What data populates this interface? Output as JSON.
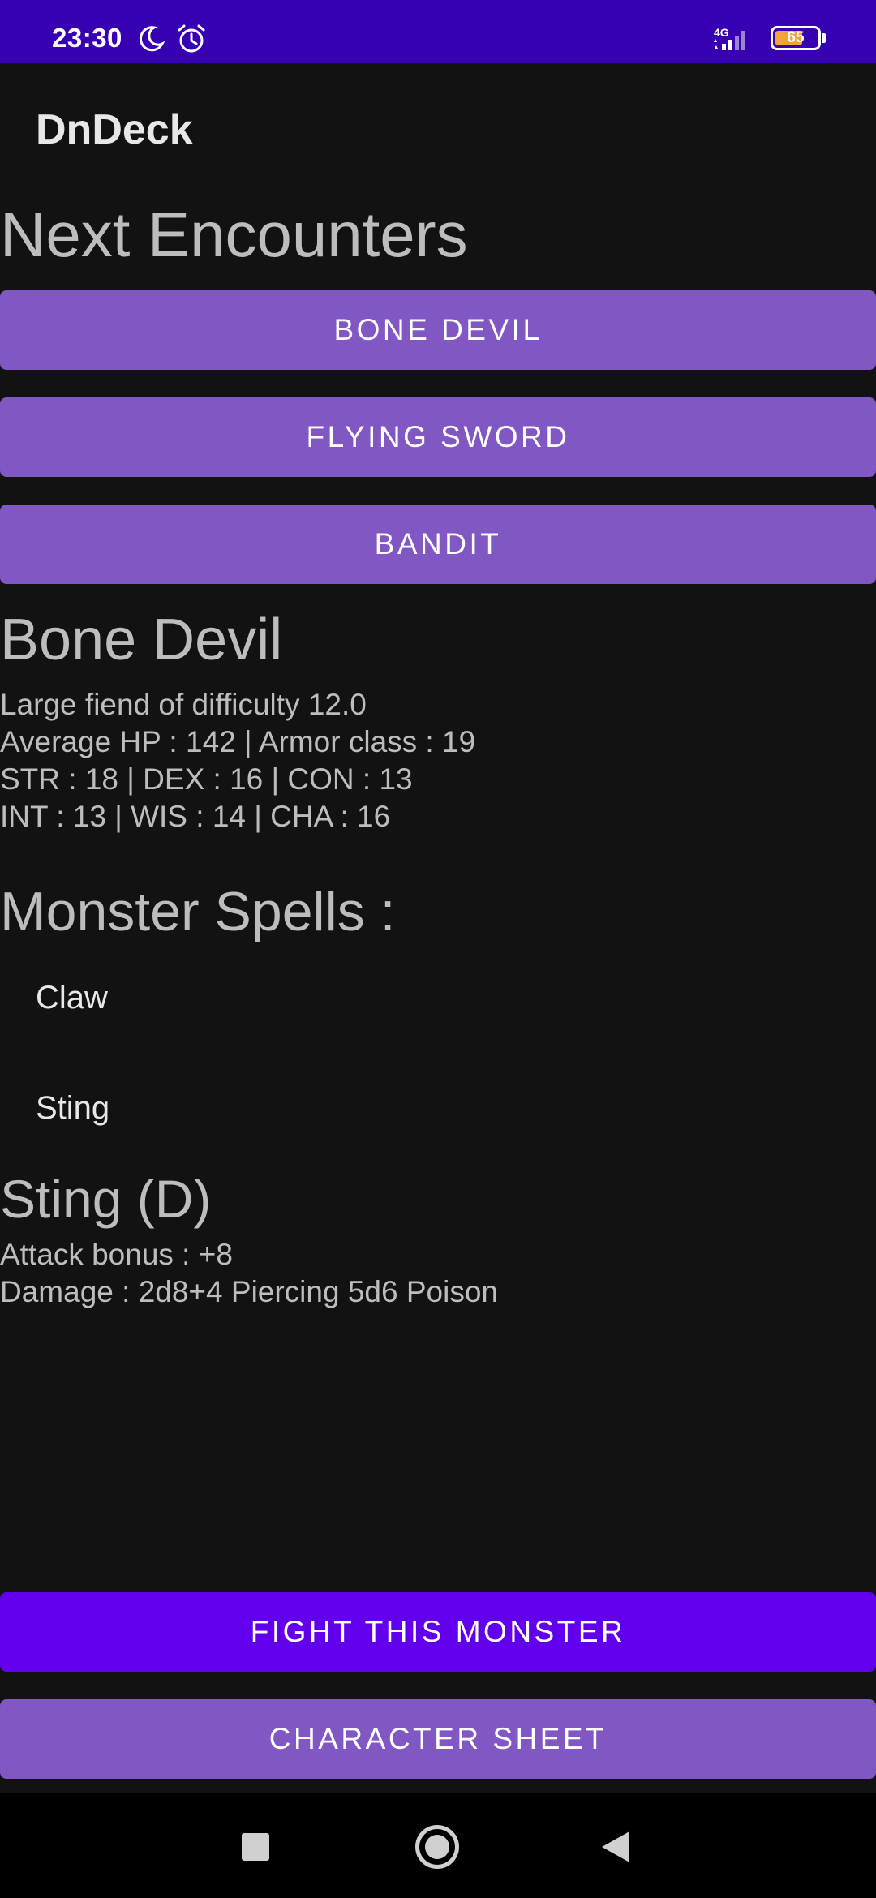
{
  "status_bar": {
    "time": "23:30",
    "network": "4G",
    "battery": "65",
    "battery_level_percent": 65,
    "icons": [
      "moon-icon",
      "alarm-icon",
      "signal-icon",
      "battery-icon"
    ],
    "background": "#3700b3"
  },
  "app_bar": {
    "title": "DnDeck"
  },
  "encounters": {
    "heading": "Next Encounters",
    "items": [
      {
        "label": "BONE DEVIL"
      },
      {
        "label": "FLYING SWORD"
      },
      {
        "label": "BANDIT"
      }
    ]
  },
  "monster": {
    "name": "Bone Devil",
    "description": "Large fiend of difficulty 12.0",
    "hp_ac": "Average HP : 142 | Armor class : 19",
    "physical_stats": "STR : 18 | DEX : 16 | CON : 13",
    "mental_stats": "INT : 13 | WIS : 14 | CHA : 16"
  },
  "spells": {
    "heading": "Monster Spells :",
    "items": [
      {
        "label": "Claw"
      },
      {
        "label": "Sting"
      }
    ]
  },
  "selected_spell": {
    "title": "Sting (D)",
    "attack_bonus": "Attack bonus : +8",
    "damage": "Damage : 2d8+4 Piercing 5d6 Poison"
  },
  "actions": {
    "fight_label": "FIGHT THIS MONSTER",
    "sheet_label": "CHARACTER SHEET"
  },
  "nav_bar": {
    "icons": [
      "recent-apps-icon",
      "home-icon",
      "back-icon"
    ]
  },
  "colors": {
    "background": "#121212",
    "button_light": "#8157c4",
    "button_primary": "#6200ee",
    "text": "#bdbdbd"
  }
}
